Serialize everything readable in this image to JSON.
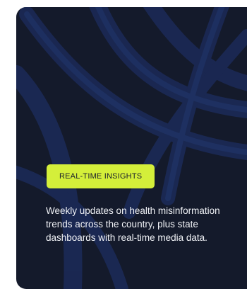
{
  "card": {
    "badge_label": "REAL-TIME INSIGHTS",
    "description": "Weekly updates on health misinformation trends across the country, plus state dashboards with real-time media data."
  },
  "colors": {
    "card_background": "#141a2b",
    "pattern_stroke": "#1c2b59",
    "badge_background": "#d4ef3a",
    "badge_text": "#1b1f2c",
    "description_text": "#f1f3f7"
  }
}
